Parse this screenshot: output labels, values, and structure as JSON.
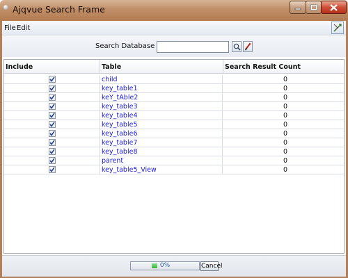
{
  "window": {
    "title": "Ajqvue Search Frame",
    "controls": [
      "minimize-icon",
      "maximize-icon",
      "close-icon"
    ]
  },
  "menubar": {
    "items": [
      {
        "label": "File"
      },
      {
        "label": "Edit"
      }
    ],
    "corner_icon": "tool-icon"
  },
  "search": {
    "label": "Search Database For :",
    "value": "",
    "placeholder": "",
    "search_icon": "magnifier-icon",
    "clear_icon": "clear-icon"
  },
  "table": {
    "columns": [
      "Include",
      "Table",
      "Search Result Count"
    ],
    "rows": [
      {
        "include": true,
        "table": "child",
        "count": "0"
      },
      {
        "include": true,
        "table": "key_table1",
        "count": "0"
      },
      {
        "include": true,
        "table": "keY_tAble2",
        "count": "0"
      },
      {
        "include": true,
        "table": "key_table3",
        "count": "0"
      },
      {
        "include": true,
        "table": "key_table4",
        "count": "0"
      },
      {
        "include": true,
        "table": "key_table5",
        "count": "0"
      },
      {
        "include": true,
        "table": "key_table6",
        "count": "0"
      },
      {
        "include": true,
        "table": "key_table7",
        "count": "0"
      },
      {
        "include": true,
        "table": "key_table8",
        "count": "0"
      },
      {
        "include": true,
        "table": "parent",
        "count": "0"
      },
      {
        "include": true,
        "table": "key_table5_View",
        "count": "0"
      }
    ]
  },
  "status": {
    "progress_text": "0%",
    "progress_value": 0.0,
    "cancel_label": "Cancel"
  },
  "colors": {
    "table_name": "#1a1adb",
    "title_bar": "#b47f56",
    "close_button": "#cf4d36"
  }
}
